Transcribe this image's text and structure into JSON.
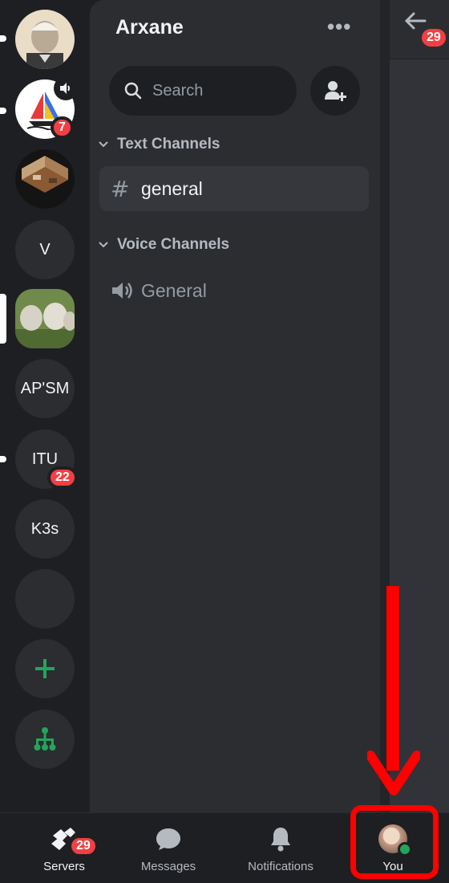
{
  "rail": {
    "servers": [
      {
        "kind": "image",
        "icon": "portrait-photo"
      },
      {
        "kind": "image",
        "icon": "sailboat-logo",
        "badge": "7",
        "voice": true
      },
      {
        "kind": "image",
        "icon": "isometric-room"
      },
      {
        "kind": "text",
        "label": "V"
      },
      {
        "kind": "image",
        "icon": "sheep-photo",
        "selected": true
      },
      {
        "kind": "text",
        "label": "AP'SM"
      },
      {
        "kind": "text",
        "label": "ITU",
        "badge": "22"
      },
      {
        "kind": "text",
        "label": "K3s"
      },
      {
        "kind": "empty"
      }
    ],
    "add_icon": "plus-icon",
    "discover_icon": "hub-icon"
  },
  "panel": {
    "server_name": "Arxane",
    "more_label": "•••",
    "search_placeholder": "Search",
    "categories": [
      {
        "label": "Text Channels",
        "channels": [
          {
            "type": "text",
            "prefix": "#",
            "label": "general",
            "active": true
          }
        ]
      },
      {
        "label": "Voice Channels",
        "channels": [
          {
            "type": "voice",
            "label": "General"
          }
        ]
      }
    ]
  },
  "peek": {
    "badge": "29"
  },
  "nav": {
    "tabs": [
      {
        "label": "Servers",
        "badge": "29"
      },
      {
        "label": "Messages"
      },
      {
        "label": "Notifications"
      },
      {
        "label": "You"
      }
    ]
  },
  "colors": {
    "rail_bg": "#1e1f22",
    "panel_bg": "#2b2d31",
    "badge_red": "#f23f43",
    "online_green": "#23a55a",
    "add_green": "#23a55a",
    "annotation_red": "#ff0000"
  }
}
